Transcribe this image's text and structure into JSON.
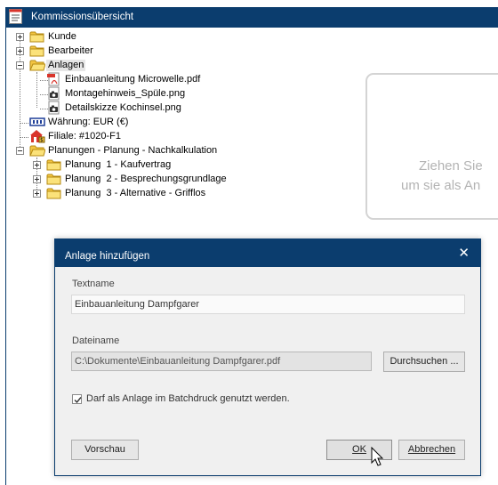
{
  "window": {
    "title": "Kommissionsübersicht"
  },
  "tree": {
    "kunde": "Kunde",
    "bearbeiter": "Bearbeiter",
    "anlagen": "Anlagen",
    "attachments": [
      {
        "label": "Einbauanleitung Microwelle.pdf",
        "icon": "pdf-icon"
      },
      {
        "label": "Montagehinweis_Spüle.png",
        "icon": "camera-icon"
      },
      {
        "label": "Detailskizze Kochinsel.png",
        "icon": "camera-icon"
      }
    ],
    "waehrung": "Währung: EUR (€)",
    "filiale": "Filiale: #1020-F1",
    "planungen": "Planungen - Planung - Nachkalkulation",
    "plans": [
      "Planung  1 - Kaufvertrag",
      "Planung  2 - Besprechungsgrundlage",
      "Planung  3 - Alternative - Grifflos"
    ]
  },
  "dropzone": {
    "line1": "Ziehen Sie",
    "line2": "um sie als An"
  },
  "dialog": {
    "title": "Anlage hinzufügen",
    "close": "✕",
    "textname_label": "Textname",
    "textname_value": "Einbauanleitung Dampfgarer",
    "dateiname_label": "Dateiname",
    "dateiname_value": "C:\\Dokumente\\Einbauanleitung Dampfgarer.pdf",
    "browse_button": "Durchsuchen ...",
    "batch_checkbox_label": "Darf als Anlage im Batchdruck genutzt werden.",
    "batch_checked": true,
    "preview_button": "Vorschau",
    "ok_button": "OK",
    "cancel_button": "Abbrechen"
  },
  "colors": {
    "titlebar": "#0b3d6e",
    "folder": "#f4c542"
  }
}
